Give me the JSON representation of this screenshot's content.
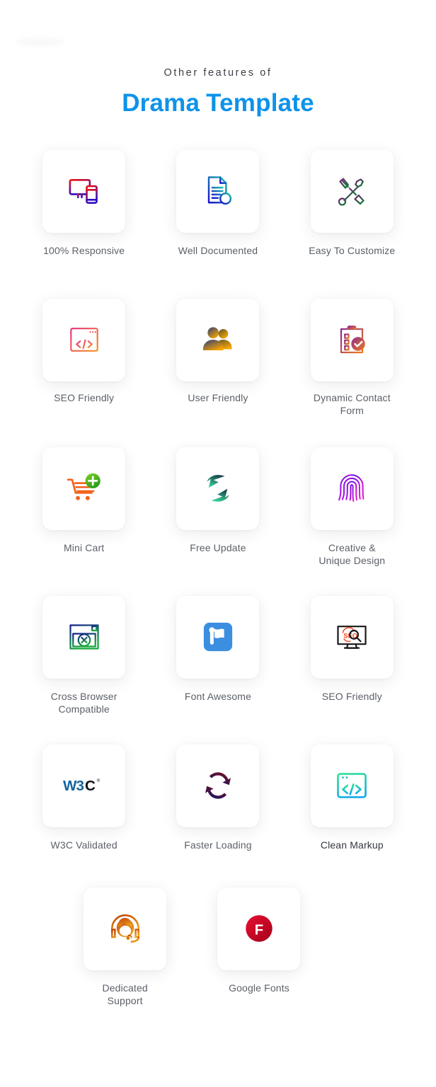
{
  "heading": {
    "eyebrow": "Other features of",
    "title_part1": "Drama",
    "title_part2": "Template",
    "accent_color": "#0d93ea",
    "eyebrow_color": "#3a3f46"
  },
  "features": [
    {
      "id": "responsive",
      "label": "100% Responsive",
      "icon": "devices-responsive-icon",
      "colors": [
        "#ee1111",
        "#2a0ec6"
      ]
    },
    {
      "id": "well-documented",
      "label": "Well Documented",
      "icon": "document-info-icon",
      "colors": [
        "#18c5a9",
        "#1a18c9"
      ]
    },
    {
      "id": "easy-customize",
      "label": "Easy To Customize",
      "icon": "wrench-screwdriver-icon",
      "colors": [
        "#7a2277",
        "#0c7a34"
      ]
    },
    {
      "id": "seo-friendly-1",
      "label": "SEO Friendly",
      "icon": "code-window-icon",
      "colors": [
        "#e8307f",
        "#f59324"
      ]
    },
    {
      "id": "user-friendly",
      "label": "User Friendly",
      "icon": "users-icon",
      "colors": [
        "#2d3b78",
        "#f5a300"
      ]
    },
    {
      "id": "dynamic-contact",
      "label": "Dynamic Contact\nForm",
      "icon": "clipboard-check-icon",
      "colors": [
        "#8e2a8e",
        "#ef7c1a"
      ]
    },
    {
      "id": "mini-cart",
      "label": "Mini Cart",
      "icon": "cart-plus-icon",
      "colors": [
        "#f4601a",
        "#3fae2a"
      ]
    },
    {
      "id": "free-update",
      "label": "Free Update",
      "icon": "refresh-arrows-icon",
      "colors": [
        "#16424a",
        "#3fdba0"
      ]
    },
    {
      "id": "creative-design",
      "label": "Creative &\nUnique Design",
      "icon": "fingerprint-icon",
      "colors": [
        "#6a14e8",
        "#f015d6"
      ]
    },
    {
      "id": "cross-browser",
      "label": "Cross Browser\nCompatible",
      "icon": "browser-close-icon",
      "colors": [
        "#15208c",
        "#18a93c"
      ]
    },
    {
      "id": "font-awesome",
      "label": "Font Awesome",
      "icon": "font-awesome-flag-icon",
      "colors": [
        "#3b8ee0",
        "#ffffff"
      ]
    },
    {
      "id": "seo-friendly-2",
      "label": "SEO Friendly",
      "icon": "monitor-seo-search-icon",
      "colors": [
        "#18181a",
        "#ef4a20"
      ]
    },
    {
      "id": "w3c-validated",
      "label": "W3C Validated",
      "icon": "w3c-logo-icon",
      "colors": [
        "#1464a0",
        "#111111"
      ]
    },
    {
      "id": "faster-loading",
      "label": "Faster Loading",
      "icon": "sync-arrows-icon",
      "colors": [
        "#7a0d1b",
        "#17186e"
      ]
    },
    {
      "id": "clean-markup",
      "label": "Clean Markup",
      "icon": "code-browser-icon",
      "colors": [
        "#2fe09a",
        "#12a8f0"
      ],
      "label_style": "dark"
    },
    {
      "id": "dedicated-support",
      "label": "Dedicated\nSupport",
      "icon": "headset-support-icon",
      "colors": [
        "#c4470c",
        "#f0a81e"
      ]
    },
    {
      "id": "google-fonts",
      "label": "Google Fonts",
      "icon": "google-fonts-f-icon",
      "colors": [
        "#e8102f",
        "#a3001c"
      ]
    }
  ]
}
